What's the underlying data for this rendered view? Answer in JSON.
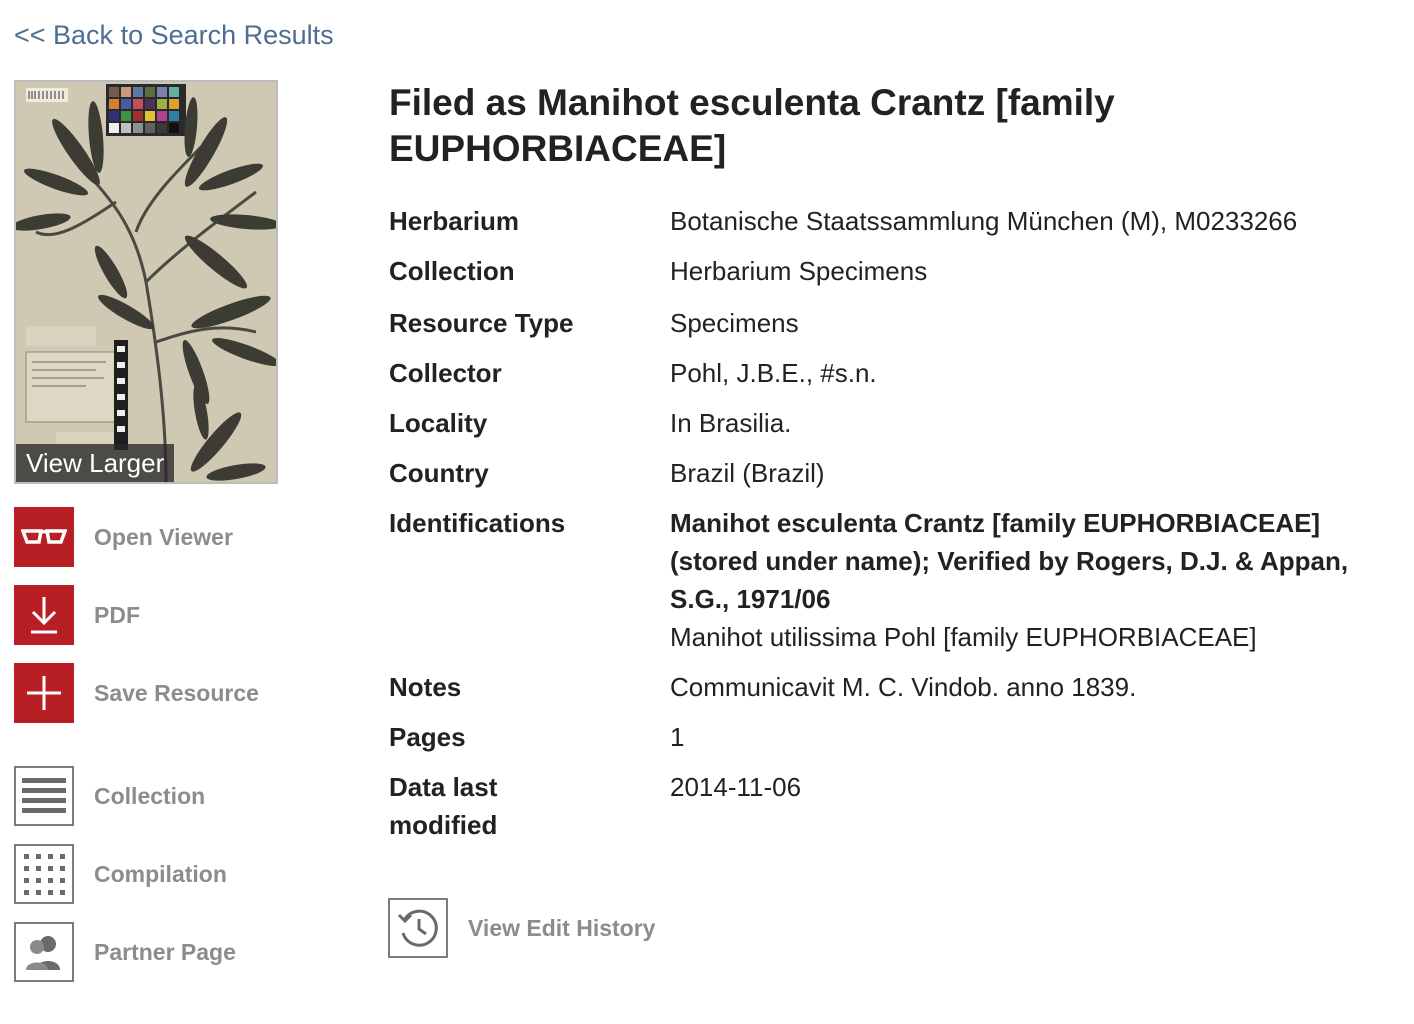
{
  "nav": {
    "back_label": "<< Back to Search Results"
  },
  "image": {
    "view_larger_label": "View Larger"
  },
  "actions": [
    {
      "label": "Open Viewer",
      "icon": "glasses-icon"
    },
    {
      "label": "PDF",
      "icon": "download-icon"
    },
    {
      "label": "Save Resource",
      "icon": "plus-icon"
    },
    {
      "label": "Collection",
      "icon": "list-icon"
    },
    {
      "label": "Compilation",
      "icon": "grid-icon"
    },
    {
      "label": "Partner Page",
      "icon": "people-icon"
    }
  ],
  "record": {
    "title": "Filed as Manihot esculenta Crantz [family EUPHORBIACEAE]",
    "fields": {
      "herbarium": {
        "label": "Herbarium",
        "value": "Botanische Staatssammlung München (M), M0233266"
      },
      "collection": {
        "label": "Collection",
        "value": "Herbarium Specimens"
      },
      "resource_type": {
        "label": "Resource Type",
        "value": "Specimens"
      },
      "collector": {
        "label": "Collector",
        "value": "Pohl, J.B.E., #s.n."
      },
      "locality": {
        "label": "Locality",
        "value": "In Brasilia."
      },
      "country": {
        "label": "Country",
        "value": "Brazil (Brazil)"
      },
      "identifications": {
        "label": "Identifications",
        "value_primary": "Manihot esculenta Crantz [family EUPHORBIACEAE] (stored under name); Verified by Rogers, D.J. & Appan, S.G., 1971/06",
        "value_secondary": "Manihot utilissima Pohl [family EUPHORBIACEAE]"
      },
      "notes": {
        "label": "Notes",
        "value": "Communicavit M. C. Vindob. anno 1839."
      },
      "pages": {
        "label": "Pages",
        "value": "1"
      },
      "data_last_modified": {
        "label": "Data last modified",
        "value": "2014-11-06"
      }
    },
    "history_label": "View Edit History"
  },
  "colors": {
    "link": "#4e6e91",
    "accent_red": "#b71f24",
    "muted_label": "#8c8c8c"
  }
}
